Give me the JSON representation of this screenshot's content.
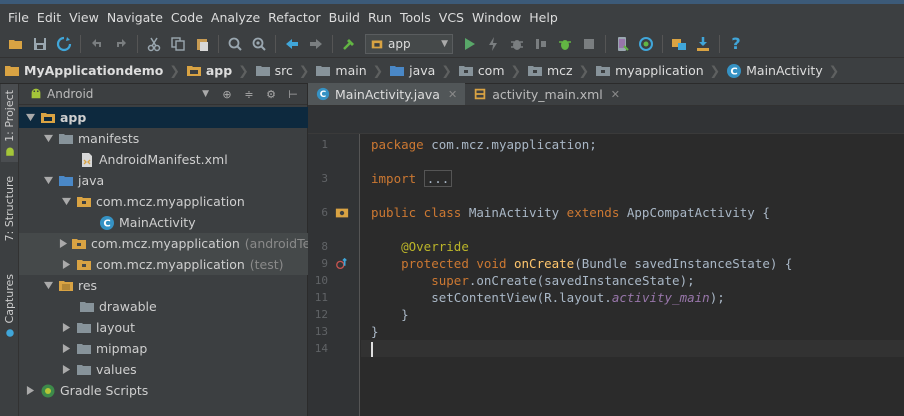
{
  "menubar": {
    "items": [
      "File",
      "Edit",
      "View",
      "Navigate",
      "Code",
      "Analyze",
      "Refactor",
      "Build",
      "Run",
      "Tools",
      "VCS",
      "Window",
      "Help"
    ]
  },
  "toolbar": {
    "run_config": "app",
    "icons": [
      "open-folder-icon",
      "save-icon",
      "sync-icon",
      "undo-icon",
      "redo-icon",
      "cut-icon",
      "copy-icon",
      "paste-icon",
      "find-icon",
      "replace-icon",
      "back-icon",
      "forward-icon",
      "make-project-icon",
      "run-icon",
      "apply-changes-icon",
      "debug-icon",
      "attach-debugger-icon",
      "run-coverage-icon",
      "stop-icon",
      "avd-manager-icon",
      "sync-gradle-icon",
      "project-structure-icon",
      "sdk-manager-icon",
      "help-icon"
    ]
  },
  "breadcrumbs": [
    "MyApplicationdemo",
    "app",
    "src",
    "main",
    "java",
    "com",
    "mcz",
    "myapplication",
    "MainActivity"
  ],
  "side_tabs": [
    "1: Project",
    "7: Structure",
    "Captures"
  ],
  "project_panel": {
    "view_mode": "Android",
    "tree": [
      {
        "label": "app",
        "suffix": ""
      },
      {
        "label": "manifests",
        "suffix": ""
      },
      {
        "label": "AndroidManifest.xml",
        "suffix": ""
      },
      {
        "label": "java",
        "suffix": ""
      },
      {
        "label": "com.mcz.myapplication",
        "suffix": ""
      },
      {
        "label": "MainActivity",
        "suffix": ""
      },
      {
        "label": "com.mcz.myapplication",
        "suffix": "(androidTest)"
      },
      {
        "label": "com.mcz.myapplication",
        "suffix": "(test)"
      },
      {
        "label": "res",
        "suffix": ""
      },
      {
        "label": "drawable",
        "suffix": ""
      },
      {
        "label": "layout",
        "suffix": ""
      },
      {
        "label": "mipmap",
        "suffix": ""
      },
      {
        "label": "values",
        "suffix": ""
      },
      {
        "label": "Gradle Scripts",
        "suffix": ""
      }
    ]
  },
  "editor": {
    "tabs": [
      {
        "label": "MainActivity.java",
        "active": true
      },
      {
        "label": "activity_main.xml",
        "active": false
      }
    ],
    "line_numbers": [
      "1",
      "3",
      "6",
      "8",
      "9",
      "10",
      "11",
      "12",
      "13",
      "14"
    ],
    "code": {
      "l1_kw": "package",
      "l1_rest": " com.mcz.myapplication;",
      "l3_kw": "import",
      "l3_fold": "...",
      "l6_kw1": "public class",
      "l6_name": " MainActivity ",
      "l6_kw2": "extends",
      "l6_rest": " AppCompatActivity {",
      "l8_ann": "@Override",
      "l9_kw": "protected void",
      "l9_fn": "onCreate",
      "l9_rest": "(Bundle savedInstanceState) {",
      "l10_kw": "super",
      "l10_rest": ".onCreate(savedInstanceState);",
      "l11_pre": "setContentView(R.layout.",
      "l11_it": "activity_main",
      "l11_post": ");",
      "l12": "}",
      "l13": "}"
    }
  },
  "colors": {
    "background": "#2b2b2b",
    "panel": "#3c3f41",
    "keyword": "#cc7832",
    "annotation": "#bbb529",
    "method": "#ffc66d",
    "field": "#9876aa",
    "selection": "#0d293e"
  }
}
